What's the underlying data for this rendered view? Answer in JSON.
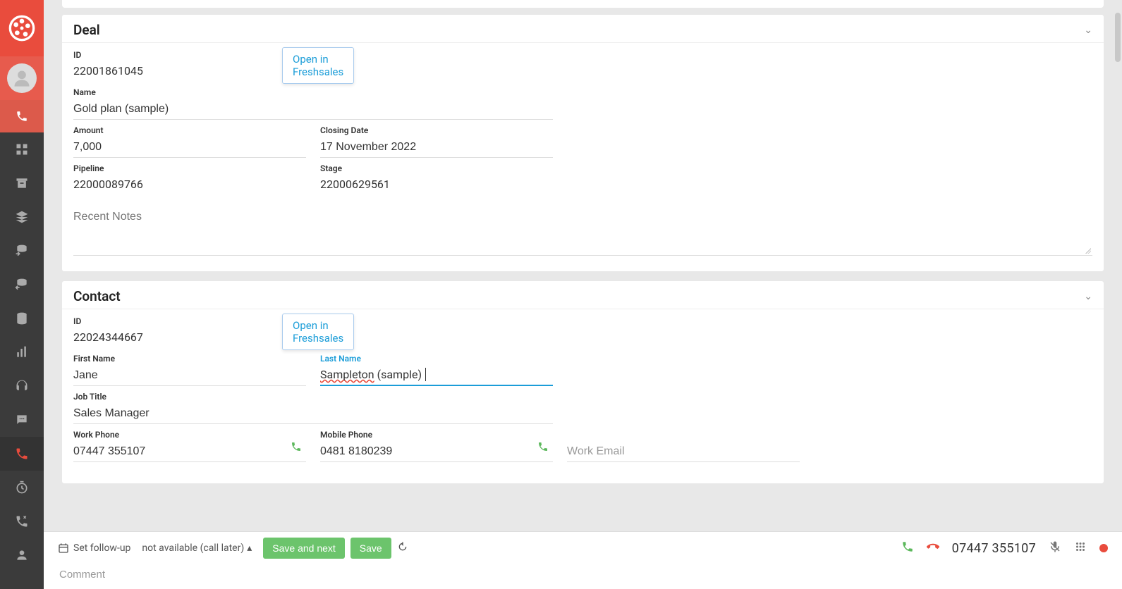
{
  "sidebar": {},
  "deal": {
    "title": "Deal",
    "id_label": "ID",
    "id": "22001861045",
    "open_link": "Open in Freshsales",
    "name_label": "Name",
    "name": "Gold plan (sample)",
    "amount_label": "Amount",
    "amount": "7,000",
    "closing_label": "Closing Date",
    "closing": "17 November 2022",
    "pipeline_label": "Pipeline",
    "pipeline": "22000089766",
    "stage_label": "Stage",
    "stage": "22000629561",
    "recent_notes_placeholder": "Recent Notes"
  },
  "contact": {
    "title": "Contact",
    "id_label": "ID",
    "id": "22024344667",
    "open_link": "Open in Freshsales",
    "first_name_label": "First Name",
    "first_name": "Jane",
    "last_name_label": "Last Name",
    "last_name_part1": "Sampleton",
    "last_name_part2": " (sample)",
    "job_title_label": "Job Title",
    "job_title": "Sales Manager",
    "work_phone_label": "Work Phone",
    "work_phone": "07447 355107",
    "mobile_phone_label": "Mobile Phone",
    "mobile_phone": "0481 8180239",
    "work_email_placeholder": "Work Email"
  },
  "footer": {
    "set_followup": "Set follow-up",
    "status_dropdown": "not available (call later)",
    "save_next": "Save and next",
    "save": "Save",
    "comment_placeholder": "Comment",
    "phone": "07447 355107"
  }
}
